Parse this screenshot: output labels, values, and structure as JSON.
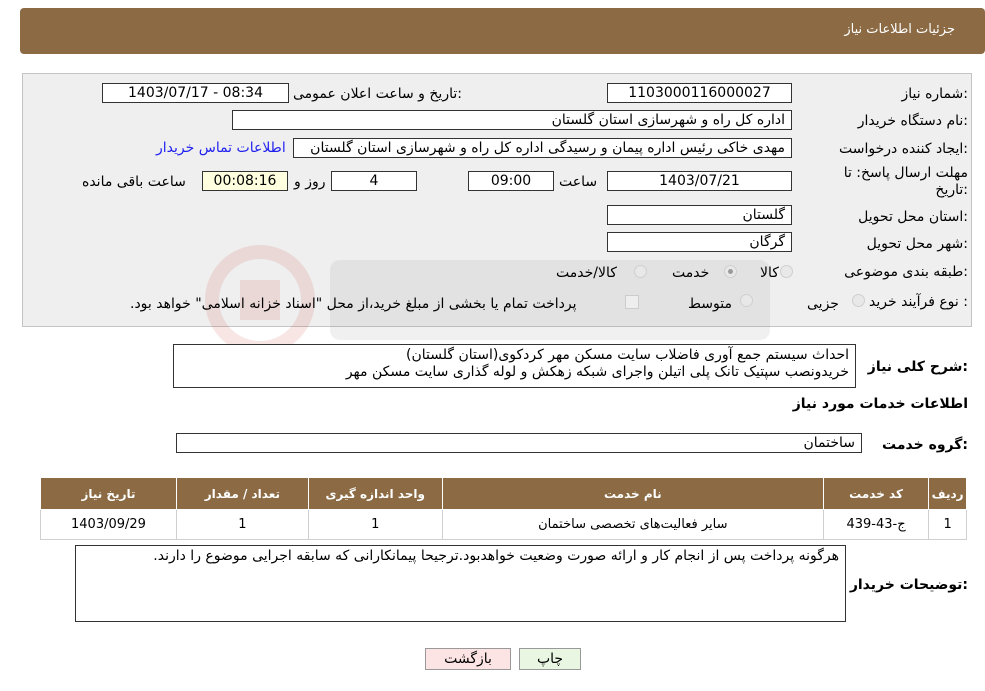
{
  "header": {
    "title": "جزئیات اطلاعات نیاز"
  },
  "form": {
    "need_number_label": "شماره نیاز:",
    "need_number": "1103000116000027",
    "announce_label": "تاریخ و ساعت اعلان عمومی:",
    "announce_value": "1403/07/17 - 08:34",
    "buyer_label": "نام دستگاه خریدار:",
    "buyer_value": "اداره کل راه و شهرسازی استان گلستان",
    "creator_label": "ایجاد کننده درخواست:",
    "creator_value": "مهدی خاکی رئیس اداره پیمان و رسیدگی اداره کل راه و شهرسازی استان گلستان",
    "contact_link": "اطلاعات تماس خریدار",
    "deadline_label": "مهلت ارسال پاسخ: تا تاریخ:",
    "deadline_date": "1403/07/21",
    "time_label": "ساعت",
    "deadline_time": "09:00",
    "days_value": "4",
    "days_label": "روز و",
    "remaining_time": "00:08:16",
    "remaining_label": "ساعت باقی مانده",
    "province_label": "استان محل تحویل:",
    "province_value": "گلستان",
    "city_label": "شهر محل تحویل:",
    "city_value": "گرگان",
    "category_label": "طبقه بندی موضوعی:",
    "category_options": [
      "کالا",
      "خدمت",
      "کالا/خدمت"
    ],
    "category_selected": "خدمت",
    "process_label": "نوع فرآیند خرید :",
    "process_options": [
      "جزیی",
      "متوسط"
    ],
    "process_note": "پرداخت تمام یا بخشی از مبلغ خرید،از محل \"اسناد خزانه اسلامی\" خواهد بود."
  },
  "summary": {
    "label": "شرح کلی نیاز:",
    "line1": "احداث سیستم جمع آوری فاضلاب سایت مسکن مهر کردکوی(استان گلستان)",
    "line2": "خریدونصب سپتیک تانک پلی اتیلن واجرای شبکه زهکش و لوله گذاری سایت مسکن مهر"
  },
  "services": {
    "title": "اطلاعات خدمات مورد نیاز",
    "group_label": "گروه خدمت:",
    "group_value": "ساختمان",
    "columns": [
      "ردیف",
      "کد خدمت",
      "نام خدمت",
      "واحد اندازه گیری",
      "تعداد / مقدار",
      "تاریخ نیاز"
    ],
    "rows": [
      [
        "1",
        "ج-43-439",
        "سایر فعالیت‌های تخصصی ساختمان",
        "1",
        "1",
        "1403/09/29"
      ]
    ]
  },
  "buyer_notes": {
    "label": "توضیحات خریدار:",
    "text": "هرگونه پرداخت پس از انجام کار و ارائه صورت وضعیت خواهدبود.ترجیحا پیمانکارانی که سابقه اجرایی موضوع را دارند."
  },
  "buttons": {
    "print": "چاپ",
    "back": "بازگشت"
  },
  "colors": {
    "header_bg": "#8b6a44",
    "link": "#1f1ff0",
    "back_btn": "#fce4e4",
    "print_btn": "#e9f7e2"
  }
}
